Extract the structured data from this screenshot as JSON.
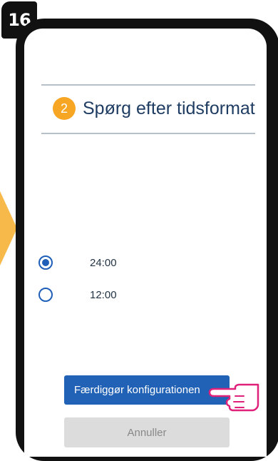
{
  "step_badge": "16",
  "header": {
    "step_number": "2",
    "title": "Spørg efter tidsformat"
  },
  "options": [
    {
      "label": "24:00",
      "selected": true
    },
    {
      "label": "12:00",
      "selected": false
    }
  ],
  "buttons": {
    "finish": "Færdiggør konfigurationen",
    "cancel": "Annuller"
  },
  "colors": {
    "accent": "#f6a623",
    "primary": "#2262b6",
    "title": "#1f3c62",
    "pointer": "#e0217a"
  },
  "icons": {
    "pointer": "pointing-hand-icon",
    "arrow": "arrow-right-icon"
  }
}
